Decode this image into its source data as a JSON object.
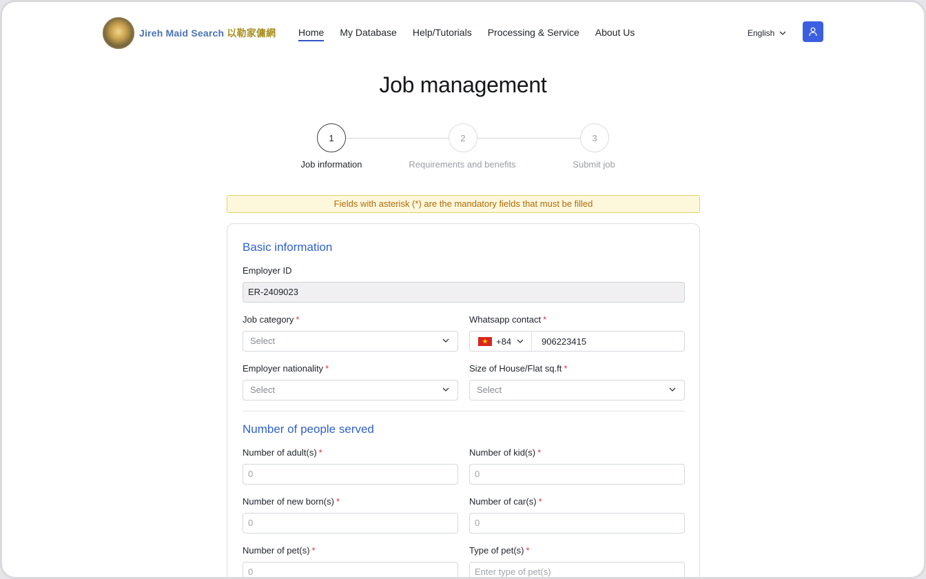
{
  "header": {
    "logo_text_en": "Jireh Maid Search",
    "logo_text_zh": "以勒家傭網",
    "nav": [
      {
        "label": "Home",
        "active": true
      },
      {
        "label": "My Database",
        "active": false
      },
      {
        "label": "Help/Tutorials",
        "active": false
      },
      {
        "label": "Processing & Service",
        "active": false
      },
      {
        "label": "About Us",
        "active": false
      }
    ],
    "language": "English",
    "user_icon": "user-icon"
  },
  "page": {
    "title": "Job management",
    "steps": [
      {
        "number": "1",
        "label": "Job information",
        "active": true
      },
      {
        "number": "2",
        "label": "Requirements and benefits",
        "active": false
      },
      {
        "number": "3",
        "label": "Submit job",
        "active": false
      }
    ],
    "notice": "Fields with asterisk (*) are the mandatory fields that must be filled"
  },
  "form": {
    "basic_title": "Basic information",
    "employer_id_label": "Employer ID",
    "employer_id_value": "ER-2409023",
    "job_category_label": "Job category",
    "job_category_placeholder": "Select",
    "whatsapp_label": "Whatsapp contact",
    "whatsapp_country_code": "+84",
    "whatsapp_number": "906223415",
    "nationality_label": "Employer nationality",
    "nationality_placeholder": "Select",
    "house_size_label": "Size of House/Flat sq.ft",
    "house_size_placeholder": "Select",
    "people_title": "Number of people served",
    "adults_label": "Number of adult(s)",
    "adults_placeholder": "0",
    "kids_label": "Number of kid(s)",
    "kids_placeholder": "0",
    "newborns_label": "Number of new born(s)",
    "newborns_placeholder": "0",
    "cars_label": "Number of car(s)",
    "cars_placeholder": "0",
    "pets_label": "Number of pet(s)",
    "pets_placeholder": "0",
    "pet_type_label": "Type of pet(s)",
    "pet_type_placeholder": "Enter type of pet(s)",
    "required_mark": "*"
  },
  "colors": {
    "accent": "#2f5fd0",
    "user_button": "#3b5fe0",
    "notice_bg": "#fdf8dc",
    "notice_text": "#b06a0a",
    "required": "#e5313b"
  }
}
